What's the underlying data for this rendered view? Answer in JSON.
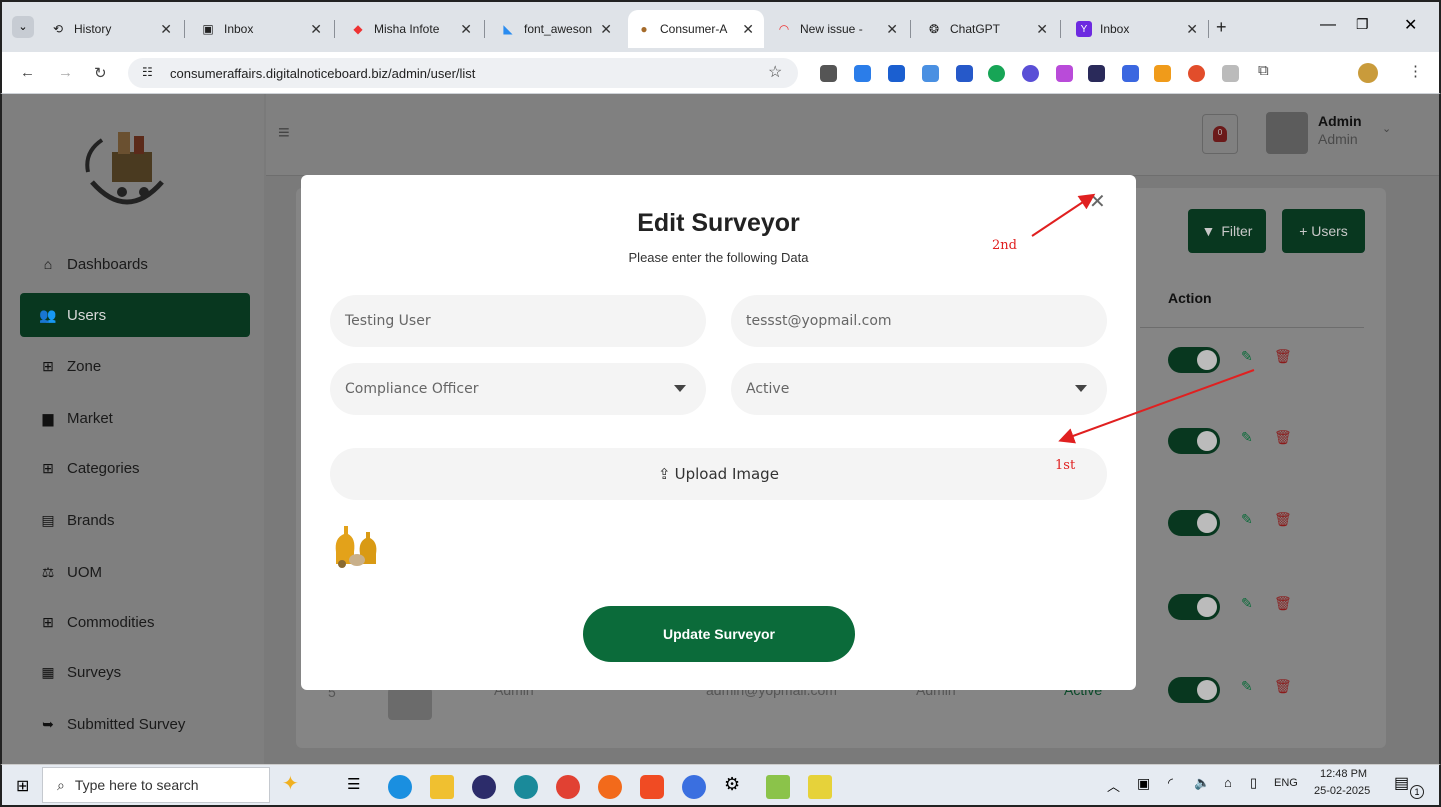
{
  "browser": {
    "tabs": [
      {
        "title": "History",
        "icon": "history-icon"
      },
      {
        "title": "Inbox",
        "icon": "inbox-icon"
      },
      {
        "title": "Misha Infote",
        "icon": "misha-icon"
      },
      {
        "title": "font_aweson",
        "icon": "flutter-icon"
      },
      {
        "title": "Consumer-A",
        "icon": "site-icon"
      },
      {
        "title": "New issue -",
        "icon": "issue-icon"
      },
      {
        "title": "ChatGPT",
        "icon": "chatgpt-icon"
      },
      {
        "title": "Inbox",
        "icon": "yahoo-icon"
      }
    ],
    "new_tab": "+",
    "url": "consumeraffairs.digitalnoticeboard.biz/admin/user/list"
  },
  "sidebar": {
    "items": [
      {
        "label": "Dashboards",
        "icon": "home-icon"
      },
      {
        "label": "Users",
        "icon": "users-icon"
      },
      {
        "label": "Zone",
        "icon": "table-icon"
      },
      {
        "label": "Market",
        "icon": "store-icon"
      },
      {
        "label": "Categories",
        "icon": "table-icon"
      },
      {
        "label": "Brands",
        "icon": "clipboard-icon"
      },
      {
        "label": "UOM",
        "icon": "scale-icon"
      },
      {
        "label": "Commodities",
        "icon": "table-icon"
      },
      {
        "label": "Surveys",
        "icon": "survey-icon"
      },
      {
        "label": "Submitted Survey",
        "icon": "submit-icon"
      }
    ]
  },
  "header": {
    "notification_count": "0",
    "user_name": "Admin",
    "user_role": "Admin"
  },
  "list": {
    "filter_label": "Filter",
    "add_label": "+ Users",
    "action_header": "Action",
    "row": {
      "index": "5",
      "name": "Admin",
      "email": "admin@yopmail.com",
      "role": "Admin",
      "status": "Active"
    }
  },
  "modal": {
    "title": "Edit Surveyor",
    "subtitle": "Please enter the following Data",
    "name_value": "Testing User",
    "email_value": "tessst@yopmail.com",
    "role_value": "Compliance Officer",
    "status_value": "Active",
    "upload_label": "Upload Image",
    "submit_label": "Update Surveyor"
  },
  "annotations": {
    "first": "1st",
    "second": "2nd",
    "color": "#e02020"
  },
  "taskbar": {
    "search_placeholder": "Type here to search",
    "lang": "ENG",
    "time": "12:48 PM",
    "date": "25-02-2025",
    "notif_count": "1"
  },
  "colors": {
    "brand_green": "#0b6b3a",
    "delete_red": "#c0392b"
  }
}
